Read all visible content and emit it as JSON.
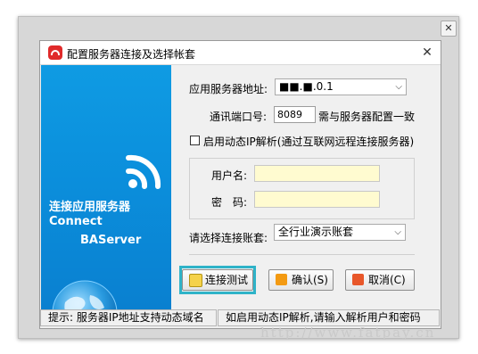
{
  "window": {
    "title": "配置服务器连接及选择帐套",
    "close_symbol": "✕",
    "outer_close_symbol": "✕"
  },
  "banner": {
    "line1": "连接应用服务器",
    "line2": "Connect",
    "line3": "BAServer"
  },
  "form": {
    "server_label": "应用服务器地址:",
    "server_value": "■■.■.0.1",
    "port_label": "通讯端口号:",
    "port_value": "8089",
    "port_hint": "需与服务器配置一致",
    "dynamic_ip_label": "启用动态IP解析(通过互联网远程连接服务器)",
    "dynamic_ip_checked": false,
    "username_label": "用户名:",
    "username_value": "",
    "password_label": "密　码:",
    "password_value": "",
    "account_label": "请选择连接账套:",
    "account_value": "全行业演示账套"
  },
  "buttons": {
    "test_label": "连接测试",
    "ok_label": "确认(S)",
    "cancel_label": "取消(C)"
  },
  "status": {
    "left": "提示: 服务器IP地址支持动态域名",
    "right": "如启用动态IP解析,请输入解析用户和密码"
  },
  "watermark": "http://www.fatpay.cn",
  "colors": {
    "banner_blue": "#0b8fdc",
    "focus_cyan": "#2fb3c8",
    "input_yellow": "#fffbd0",
    "ok_icon": "#f39a12",
    "cancel_icon": "#e8572a"
  }
}
